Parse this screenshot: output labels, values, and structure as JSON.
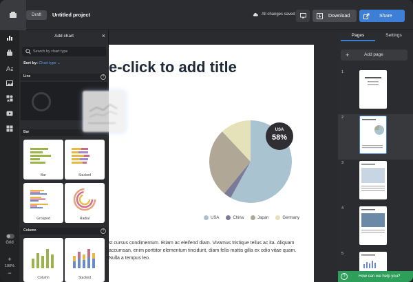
{
  "topbar": {
    "draft_label": "Draft",
    "project_title": "Untitled project",
    "saved_status": "All changes saved",
    "download_label": "Download",
    "share_label": "Share"
  },
  "rail": {
    "icons": [
      "chart-icon",
      "briefcase-icon",
      "text-icon",
      "image-icon",
      "shapes-icon",
      "video-icon",
      "apps-icon"
    ],
    "grid_label": "Grid",
    "zoom_plus": "+",
    "zoom_value": "100%",
    "zoom_minus": "−"
  },
  "add_chart_panel": {
    "title": "Add chart",
    "close": "×",
    "search_placeholder": "Search by chart type",
    "sort_by_label": "Sort by:",
    "sort_by_value": "Chart type",
    "sections": [
      {
        "label": "Line"
      },
      {
        "label": "Bar",
        "cards": [
          "Bar",
          "Stacked",
          "Grouped",
          "Radial"
        ]
      },
      {
        "label": "Column",
        "cards": [
          "Column",
          "Stacked"
        ]
      }
    ]
  },
  "canvas": {
    "title_placeholder": "e-click to add title",
    "body_text": "st cursus condimentum. Etiam ac eleifend diam. Vivamus tristique tellus ac ita. Aliquam accumsan, enim porttitor elementum tincidunt, diam felis mattis gilla ex odio vitae quam. Nulla a tempus leo.",
    "badge_label": "USA",
    "badge_value": "58%"
  },
  "chart_data": {
    "type": "pie",
    "categories": [
      "USA",
      "China",
      "Japan",
      "Germany"
    ],
    "values": [
      58,
      3,
      27,
      12
    ],
    "colors": [
      "#a9c3d1",
      "#7a7a99",
      "#b0a796",
      "#e5e1b8"
    ],
    "title": "",
    "legend_position": "bottom"
  },
  "right_panel": {
    "tabs": [
      "Pages",
      "Settings"
    ],
    "add_page_label": "Add page",
    "pages": [
      "1",
      "2",
      "3",
      "4",
      "5"
    ],
    "help_text": "How can we help you?"
  }
}
